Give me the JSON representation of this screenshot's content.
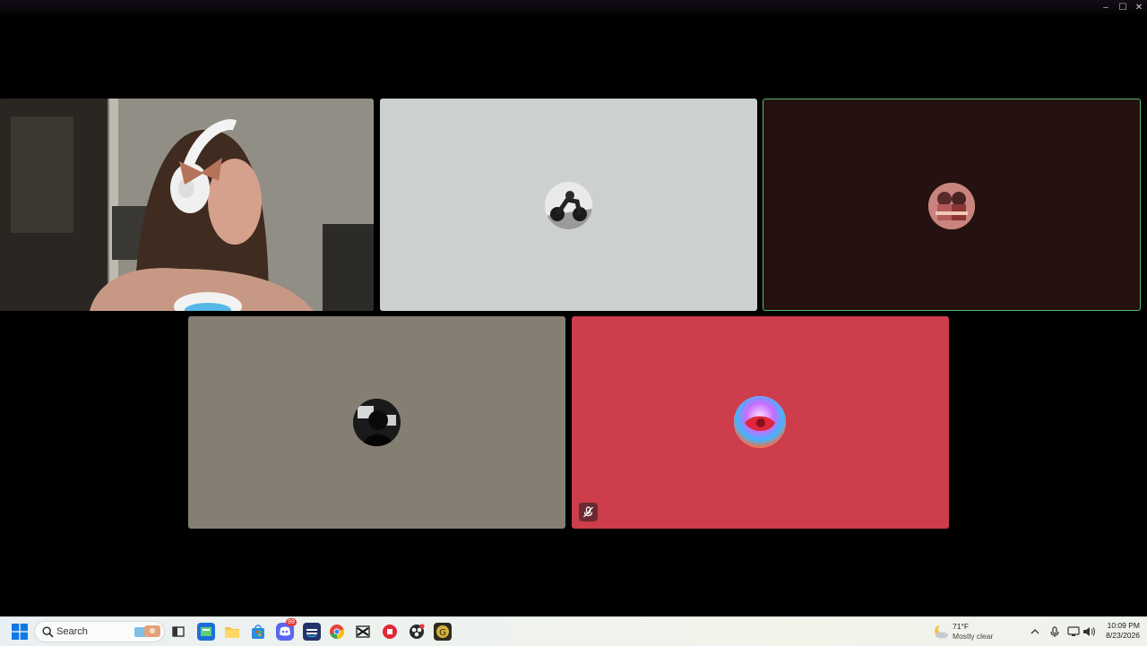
{
  "window": {
    "controls": {
      "minimize": "–",
      "maximize": "☐",
      "close": "✕"
    }
  },
  "call": {
    "tiles": [
      {
        "id": "self-video",
        "bg": "#6f6b61",
        "kind": "camera"
      },
      {
        "id": "participant-2",
        "bg": "#ccd1cf",
        "kind": "avatar",
        "avatar_colors": [
          "#f2f2f2",
          "#1e1e1e"
        ]
      },
      {
        "id": "participant-3",
        "bg": "#241110",
        "kind": "avatar",
        "highlighted": true,
        "highlight_color": "#4fc06a",
        "avatar_colors": [
          "#d58a84",
          "#5a2a28"
        ]
      },
      {
        "id": "participant-4",
        "bg": "#857f73",
        "kind": "avatar",
        "avatar_colors": [
          "#3a3a3a",
          "#0a0a0a"
        ]
      },
      {
        "id": "participant-5",
        "bg": "#cd3d4b",
        "kind": "avatar",
        "muted": true,
        "avatar_colors": [
          "#f3c1ff",
          "#e0263a"
        ]
      }
    ]
  },
  "taskbar": {
    "search_placeholder": "Search",
    "discord_badge": "99",
    "weather": {
      "temp": "71°F",
      "condition": "Mostly clear"
    },
    "clock": {
      "time": "10:09 PM",
      "date": "8/23/2026"
    },
    "icons": [
      "windows-start-icon",
      "search-icon",
      "widgets-icon",
      "task-view-icon",
      "news-app-icon",
      "file-explorer-icon",
      "microsoft-store-icon",
      "discord-icon",
      "amazon-music-icon",
      "chrome-icon",
      "capcut-icon",
      "record-app-icon",
      "obs-icon",
      "game-app-icon"
    ],
    "colors": {
      "start": "#0f7ae5",
      "discord": "#5865f2",
      "chrome_red": "#ea4335",
      "chrome_yellow": "#fbbc05",
      "chrome_green": "#34a853"
    }
  }
}
